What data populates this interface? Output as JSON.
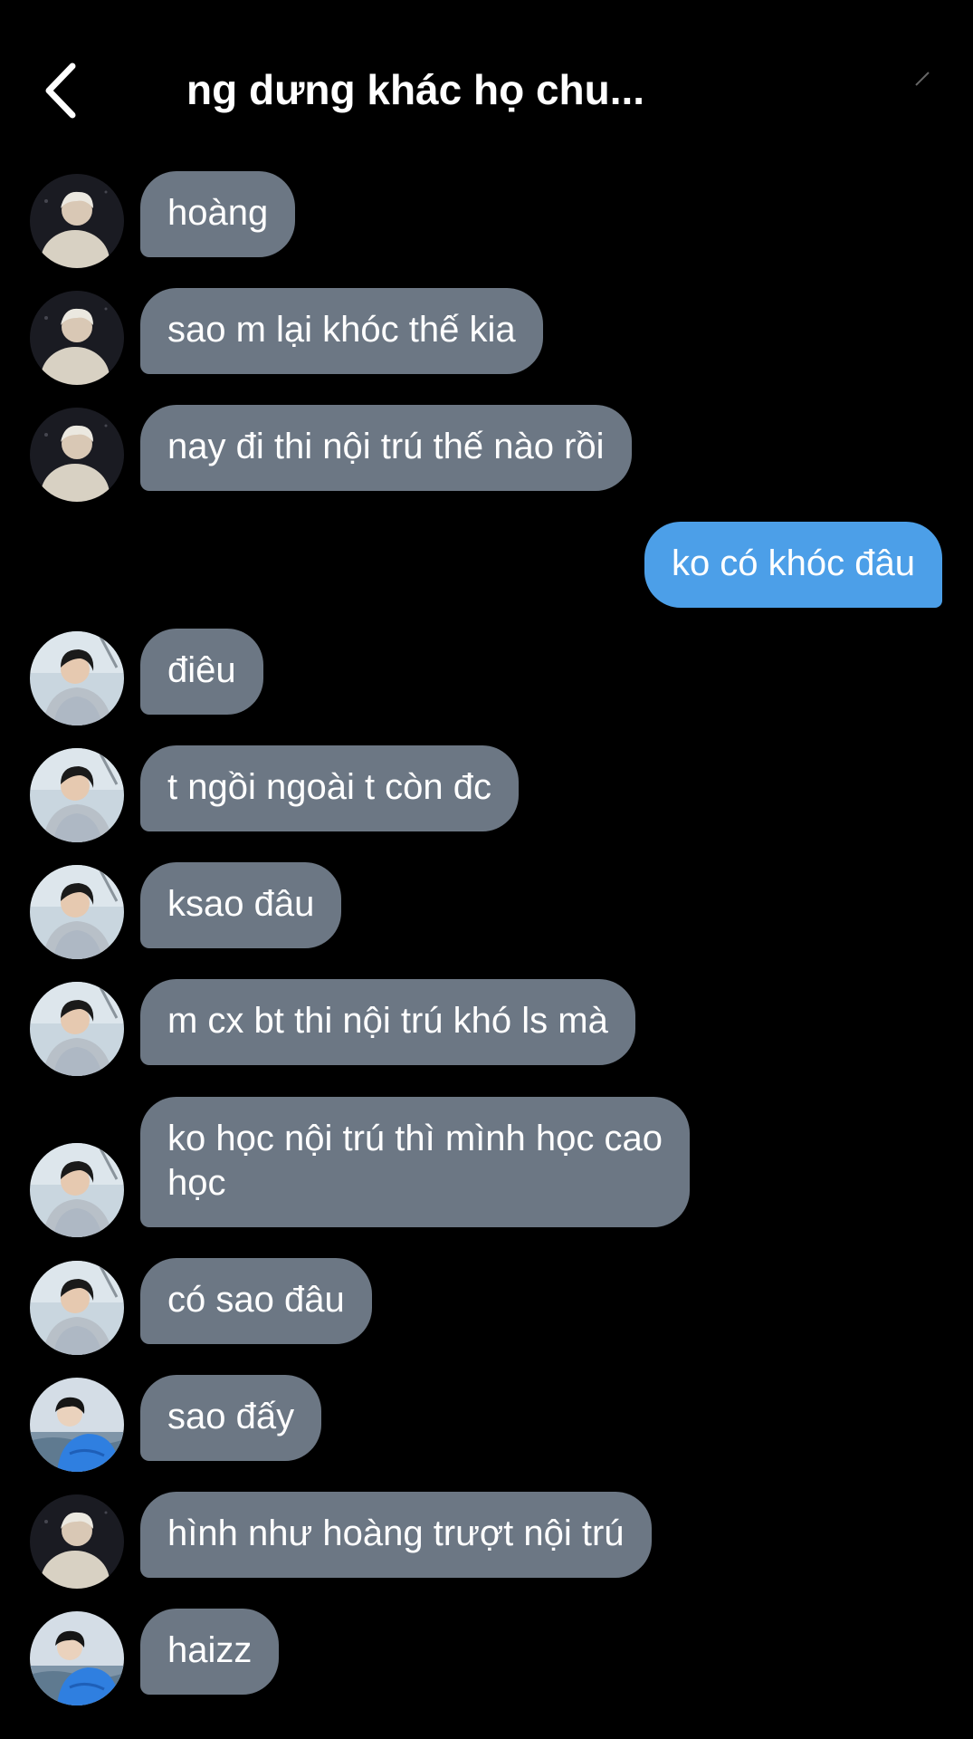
{
  "header": {
    "title": "ng dưng khác họ chu...",
    "back_icon": "chevron-left-icon"
  },
  "colors": {
    "background": "#000000",
    "incoming_bubble": "#6c7784",
    "outgoing_bubble": "#4c9fe8",
    "text": "#ffffff"
  },
  "messages": [
    {
      "text": "hoàng",
      "direction": "incoming",
      "avatar": "avatar-a"
    },
    {
      "text": "sao m lại khóc thế kia",
      "direction": "incoming",
      "avatar": "avatar-a"
    },
    {
      "text": "nay đi thi nội trú thế nào rồi",
      "direction": "incoming",
      "avatar": "avatar-a"
    },
    {
      "text": "ko có khóc đâu",
      "direction": "outgoing"
    },
    {
      "text": "điêu",
      "direction": "incoming",
      "avatar": "avatar-b"
    },
    {
      "text": "t ngồi ngoài t còn đc",
      "direction": "incoming",
      "avatar": "avatar-b"
    },
    {
      "text": "ksao đâu",
      "direction": "incoming",
      "avatar": "avatar-b"
    },
    {
      "text": "m cx bt thi nội trú khó ls mà",
      "direction": "incoming",
      "avatar": "avatar-b"
    },
    {
      "text": "ko học nội trú thì mình học cao\nhọc",
      "direction": "incoming",
      "avatar": "avatar-b"
    },
    {
      "text": "có sao đâu",
      "direction": "incoming",
      "avatar": "avatar-b"
    },
    {
      "text": "sao đấy",
      "direction": "incoming",
      "avatar": "avatar-c"
    },
    {
      "text": "hình như hoàng trượt nội trú",
      "direction": "incoming",
      "avatar": "avatar-a"
    },
    {
      "text": "haizz",
      "direction": "incoming",
      "avatar": "avatar-c"
    }
  ]
}
